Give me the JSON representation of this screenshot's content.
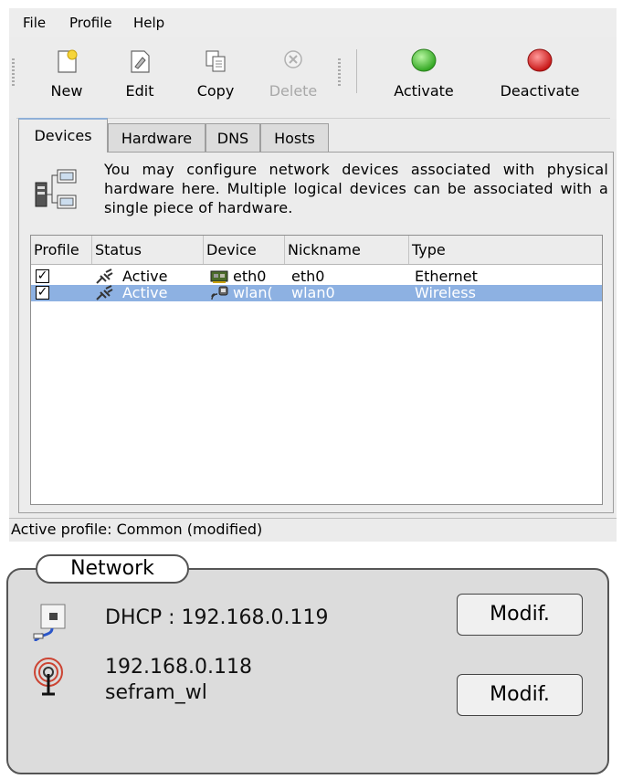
{
  "menu": {
    "items": [
      "File",
      "Profile",
      "Help"
    ]
  },
  "toolbar": {
    "new_label": "New",
    "edit_label": "Edit",
    "copy_label": "Copy",
    "delete_label": "Delete",
    "activate_label": "Activate",
    "deactivate_label": "Deactivate"
  },
  "tabs": [
    "Devices",
    "Hardware",
    "DNS",
    "Hosts"
  ],
  "info_text": "You may configure network devices associated with physical hardware here.  Multiple logical devices can be associated with a single piece of hardware.",
  "table": {
    "columns": [
      "Profile",
      "Status",
      "Device",
      "Nickname",
      "Type"
    ],
    "rows": [
      {
        "profile_checked": true,
        "status": "Active",
        "device": "eth0",
        "nickname": "eth0",
        "type": "Ethernet",
        "selected": false
      },
      {
        "profile_checked": true,
        "status": "Active",
        "device": "wlan(",
        "nickname": "wlan0",
        "type": "Wireless",
        "selected": true
      }
    ]
  },
  "statusbar": {
    "text": "Active profile: Common (modified)"
  },
  "network": {
    "title": "Network",
    "wired_text": "DHCP : 192.168.0.119",
    "wireless_ip": "192.168.0.118",
    "wireless_ssid": "sefram_wl",
    "modify_label": "Modif."
  },
  "colors": {
    "selection": "#8db1e2",
    "activate_green": "#3bb82b",
    "deactivate_red": "#d91c1c"
  },
  "icons": {
    "new": "new-document-icon",
    "edit": "edit-icon",
    "copy": "copy-icon",
    "delete": "delete-icon",
    "activate": "green-circle-icon",
    "deactivate": "red-circle-icon",
    "status": "connection-plug-icon",
    "ethernet": "network-card-icon",
    "wireless": "wireless-card-icon",
    "wired": "wired-network-icon",
    "antenna": "antenna-icon"
  }
}
